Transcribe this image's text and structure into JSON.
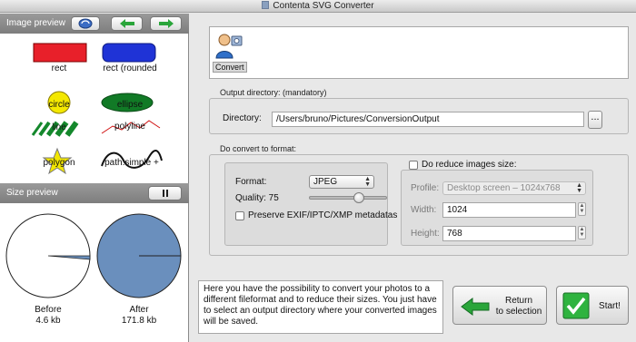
{
  "window": {
    "title": "Contenta SVG Converter"
  },
  "left_panel": {
    "image_preview_label": "Image preview",
    "thumbnails": [
      {
        "label": "rect"
      },
      {
        "label": "rect (rounded"
      },
      {
        "label": "circle"
      },
      {
        "label": "ellipse"
      },
      {
        "label": "line"
      },
      {
        "label": "polyline"
      },
      {
        "label": "polygon"
      },
      {
        "label": "path:simple +"
      }
    ],
    "size_preview_label": "Size preview",
    "before": {
      "label": "Before",
      "size": "4.6 kb"
    },
    "after": {
      "label": "After",
      "size": "171.8 kb"
    }
  },
  "toolbar": {
    "convert_label": "Convert"
  },
  "output": {
    "group_title": "Output directory: (mandatory)",
    "directory_label": "Directory:",
    "directory_value": "/Users/bruno/Pictures/ConversionOutput",
    "browse_label": "..."
  },
  "format_section": {
    "group_title": "Do convert to format:",
    "format_label": "Format:",
    "format_value": "JPEG",
    "quality_label": "Quality: 75",
    "quality_value": 75,
    "preserve_label": "Preserve EXIF/IPTC/XMP metadatas",
    "preserve_checked": false
  },
  "reduce_section": {
    "checkbox_label": "Do reduce images size:",
    "checked": false,
    "profile_label": "Profile:",
    "profile_value": "Desktop screen – 1024x768",
    "width_label": "Width:",
    "width_value": "1024",
    "height_label": "Height:",
    "height_value": "768"
  },
  "help_text": "Here you have the possibility to convert your photos to a different fileformat and to reduce their sizes. You just have to select an output directory where your converted images will be saved.",
  "buttons": {
    "return_line1": "Return",
    "return_line2": "to selection",
    "start": "Start!"
  },
  "colors": {
    "rect_fill": "#e8202a",
    "rounded_fill": "#1f33d6",
    "circle_fill": "#f4e800",
    "ellipse_fill": "#117a26",
    "line_green": "#14882c",
    "polygon_fill": "#f2e600",
    "pie_after": "#6a8fbd",
    "arrow_green": "#2aa53a"
  }
}
